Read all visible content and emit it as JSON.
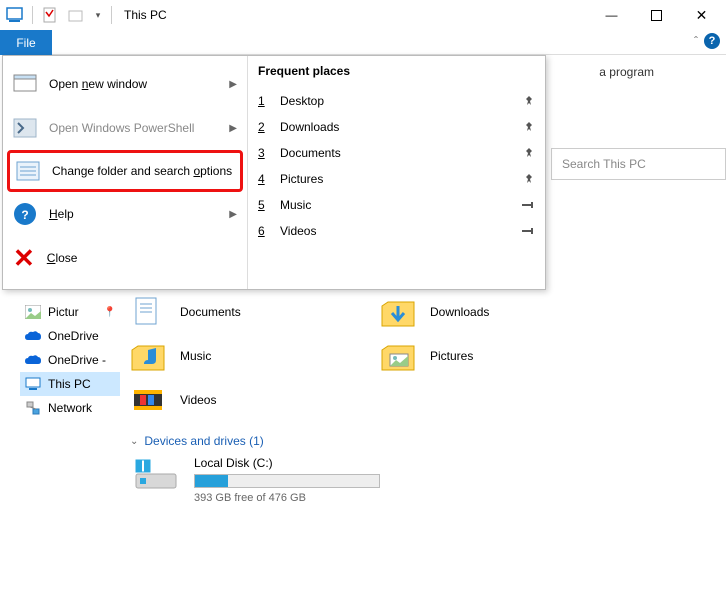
{
  "window": {
    "title": "This PC",
    "minimize": "—",
    "maximize": "□",
    "close": "✕"
  },
  "ribbon": {
    "file_tab": "File",
    "collapse_glyph": "ˆ",
    "help_glyph": "?"
  },
  "hint_text": "a program",
  "search": {
    "placeholder": "Search This PC"
  },
  "file_menu": {
    "open_new_window": "Open new window",
    "open_powershell": "Open Windows PowerShell",
    "change_options": "Change folder and search options",
    "help": "Help",
    "close": "Close",
    "frequent_header": "Frequent places",
    "places": [
      {
        "n": "1",
        "name": "Desktop",
        "pin": "📌"
      },
      {
        "n": "2",
        "name": "Downloads",
        "pin": "📌"
      },
      {
        "n": "3",
        "name": "Documents",
        "pin": "📌"
      },
      {
        "n": "4",
        "name": "Pictures",
        "pin": "📌"
      },
      {
        "n": "5",
        "name": "Music",
        "pin": "⟞"
      },
      {
        "n": "6",
        "name": "Videos",
        "pin": "⟞"
      }
    ]
  },
  "tree": {
    "pictures": "Pictur",
    "onedrive1": "OneDrive",
    "onedrive2": "OneDrive -",
    "thispc": "This PC",
    "network": "Network"
  },
  "content": {
    "documents": "Documents",
    "downloads": "Downloads",
    "music": "Music",
    "pictures": "Pictures",
    "videos": "Videos",
    "devices_header": "Devices and drives (1)",
    "drive_name": "Local Disk (C:)",
    "drive_free": "393 GB free of 476 GB"
  }
}
